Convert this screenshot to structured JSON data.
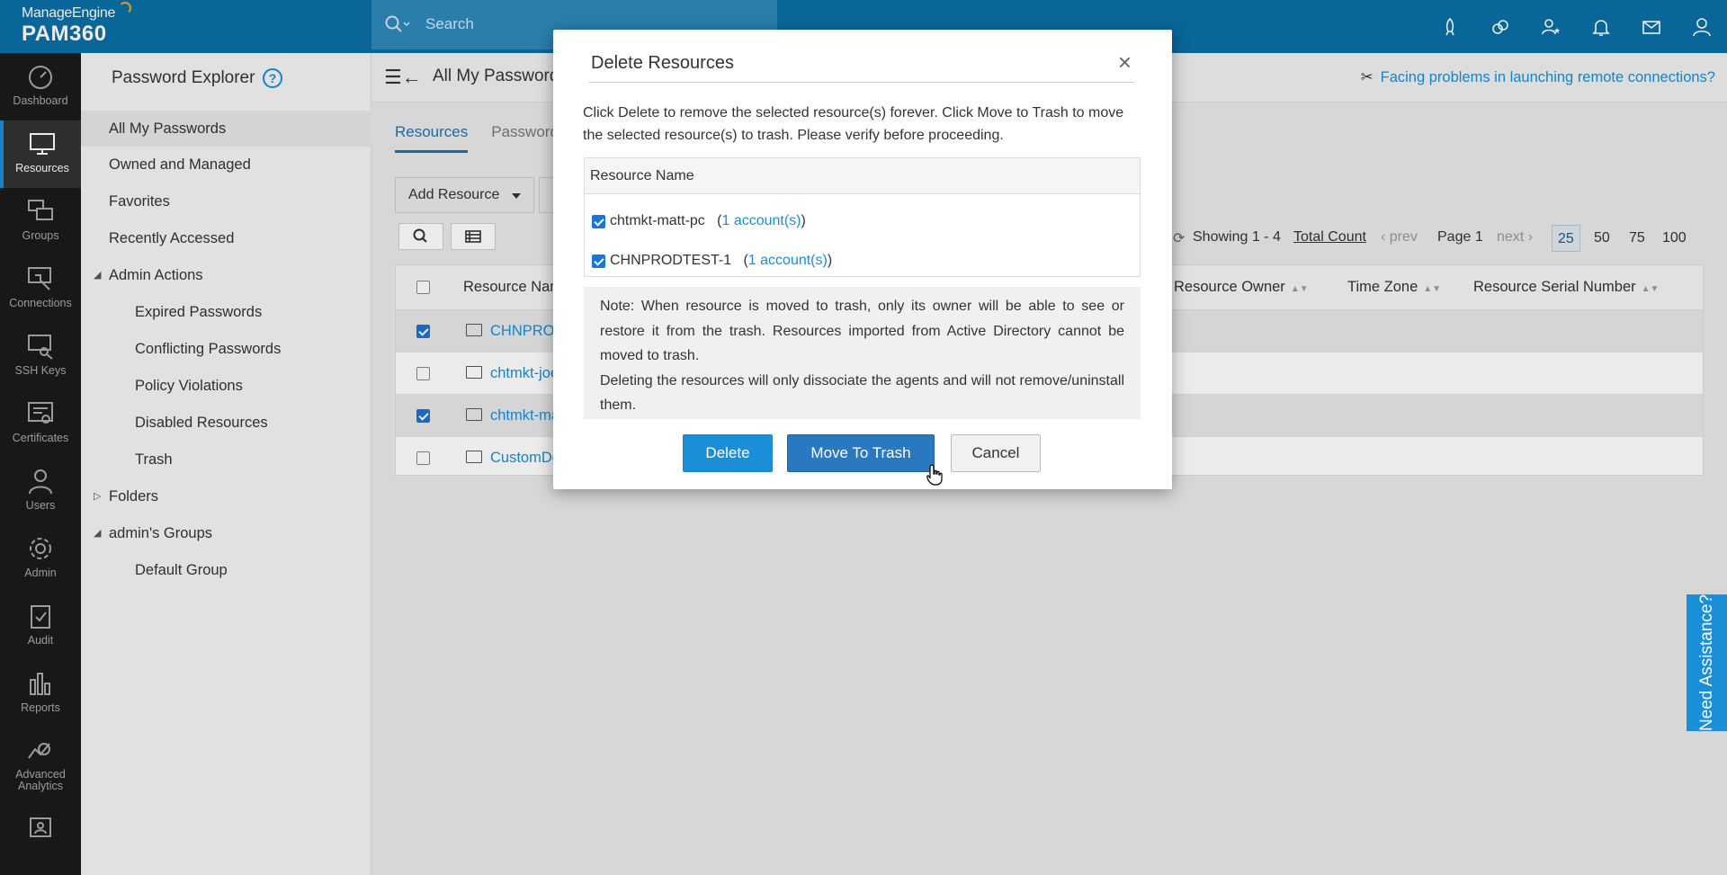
{
  "topbar": {
    "brand": "ManageEngine",
    "product": "PAM360",
    "search_placeholder": "Search"
  },
  "leftnav": [
    {
      "label": "Dashboard",
      "icon": "dashboard-icon"
    },
    {
      "label": "Resources",
      "icon": "monitor-icon",
      "active": true
    },
    {
      "label": "Groups",
      "icon": "groups-icon"
    },
    {
      "label": "Connections",
      "icon": "connections-icon"
    },
    {
      "label": "SSH Keys",
      "icon": "ssh-keys-icon"
    },
    {
      "label": "Certificates",
      "icon": "certificates-icon"
    },
    {
      "label": "Users",
      "icon": "users-icon"
    },
    {
      "label": "Admin",
      "icon": "gear-icon"
    },
    {
      "label": "Audit",
      "icon": "audit-icon"
    },
    {
      "label": "Reports",
      "icon": "reports-icon"
    },
    {
      "label": "Advanced Analytics",
      "label_line1": "Advanced",
      "label_line2": "Analytics",
      "icon": "analytics-icon"
    }
  ],
  "sidebar": {
    "title": "Password Explorer",
    "help": "?",
    "items": [
      {
        "label": "All My Passwords",
        "selected": true
      },
      {
        "label": "Owned and Managed"
      },
      {
        "label": "Favorites"
      },
      {
        "label": "Recently Accessed"
      }
    ],
    "admin_actions": {
      "label": "Admin Actions",
      "items": [
        "Expired Passwords",
        "Conflicting Passwords",
        "Policy Violations",
        "Disabled Resources",
        "Trash"
      ]
    },
    "folders": "Folders",
    "admins_groups": {
      "label": "admin's Groups",
      "items": [
        "Default Group"
      ]
    }
  },
  "main": {
    "title": "All My Passwords",
    "problem_link": "Facing problems in launching remote connections?",
    "tabs": [
      "Resources",
      "Passwords"
    ],
    "add_resource": "Add Resource",
    "paging": {
      "showing": "Showing 1 - 4",
      "total_count": "Total Count",
      "prev": "prev",
      "page": "Page 1",
      "next": "next",
      "sizes": [
        "25",
        "50",
        "75",
        "100"
      ]
    },
    "columns": {
      "resource_name": "Resource Name",
      "resource_owner": "Resource Owner",
      "time_zone": "Time Zone",
      "serial": "Resource Serial Number"
    },
    "rows": [
      {
        "name": "CHNPRODTEST-1",
        "checked": true
      },
      {
        "name": "chtmkt-joe-pc",
        "checked": false
      },
      {
        "name": "chtmkt-matt-pc",
        "checked": true
      },
      {
        "name": "CustomDevice",
        "checked": false
      }
    ]
  },
  "modal": {
    "title": "Delete Resources",
    "close": "×",
    "description": "Click Delete to remove the selected resource(s) forever. Click Move to Trash to move the selected resource(s) to trash. Please verify before proceeding.",
    "table_header": "Resource Name",
    "resources": [
      {
        "name": "chtmkt-matt-pc",
        "accounts": "1 account(s)"
      },
      {
        "name": "CHNPRODTEST-1",
        "accounts": "1 account(s)"
      }
    ],
    "note_1": "Note: When resource is moved to trash, only its owner will be able to see or restore it from the trash. Resources imported from Active Directory cannot be moved to trash.",
    "note_2": "Deleting the resources will only dissociate the agents and will not remove/uninstall them.",
    "buttons": {
      "delete": "Delete",
      "move_to_trash": "Move To Trash",
      "cancel": "Cancel"
    }
  },
  "assist": "Need Assistance?",
  "colors": {
    "topbar": "#0a6fa7",
    "accent": "#1a8fd8",
    "nav_bg": "#1b1b1b"
  }
}
